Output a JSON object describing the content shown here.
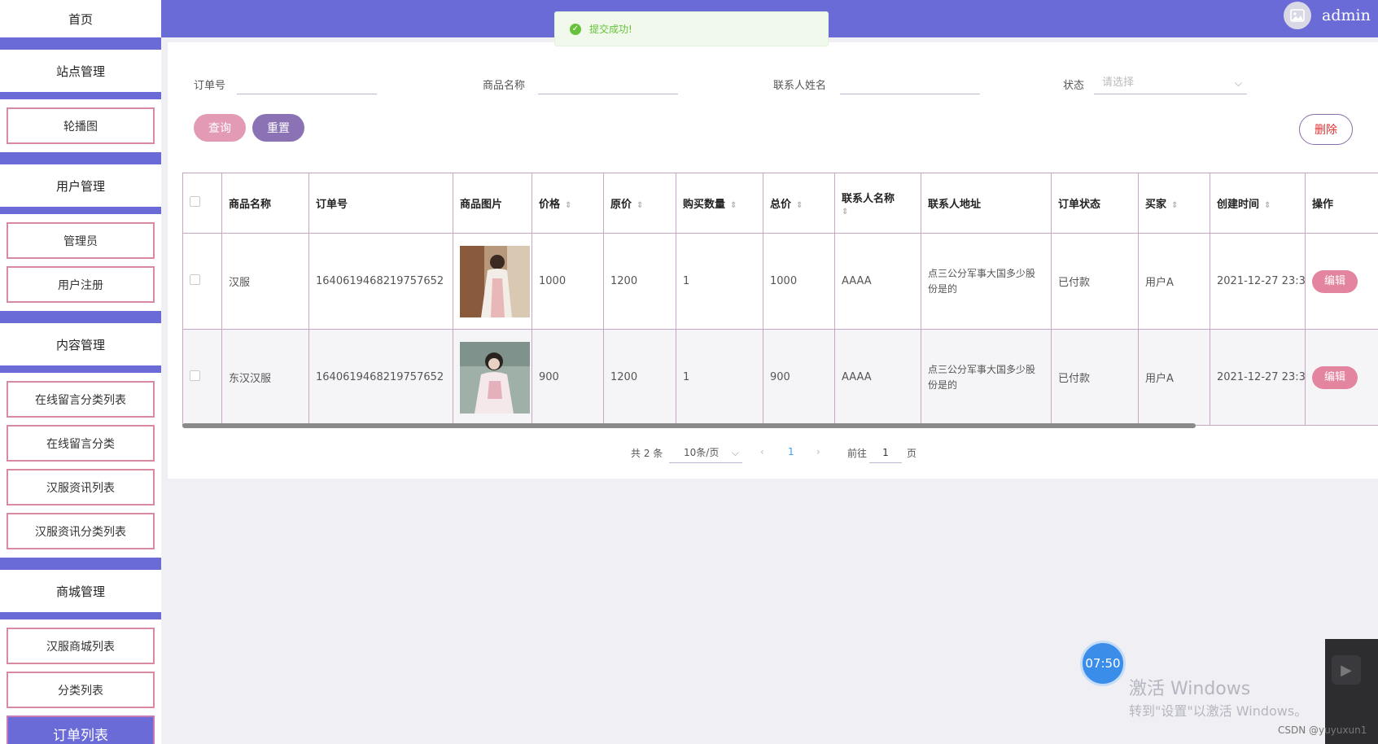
{
  "sidebar": {
    "home": "首页",
    "groups": [
      {
        "title": "站点管理",
        "items": [
          "轮播图"
        ]
      },
      {
        "title": "用户管理",
        "items": [
          "管理员",
          "用户注册"
        ]
      },
      {
        "title": "内容管理",
        "items": [
          "在线留言分类列表",
          "在线留言分类",
          "汉服资讯列表",
          "汉服资讯分类列表"
        ]
      },
      {
        "title": "商城管理",
        "items": [
          "汉服商城列表",
          "分类列表",
          "订单列表"
        ]
      }
    ],
    "active_item": "订单列表"
  },
  "header": {
    "username": "admin",
    "avatar_icon": "image-icon"
  },
  "toast": {
    "message": "提交成功!",
    "icon": "check-circle-icon"
  },
  "search": {
    "order_no_label": "订单号",
    "product_name_label": "商品名称",
    "contact_name_label": "联系人姓名",
    "status_label": "状态",
    "status_placeholder": "请选择",
    "query_button": "查询",
    "reset_button": "重置",
    "delete_button": "删除"
  },
  "table": {
    "columns": [
      "商品名称",
      "订单号",
      "商品图片",
      "价格",
      "原价",
      "购买数量",
      "总价",
      "联系人名称",
      "联系人地址",
      "订单状态",
      "买家",
      "创建时间",
      "操作"
    ],
    "rows": [
      {
        "product_name": "汉服",
        "order_no": "1640619468219757652",
        "price": "1000",
        "original_price": "1200",
        "quantity": "1",
        "total": "1000",
        "contact_name": "AAAA",
        "contact_address": "点三公分军事大国多少股份是的",
        "status": "已付款",
        "buyer": "用户A",
        "created": "2021-12-27 23:3",
        "action": "编辑"
      },
      {
        "product_name": "东汉汉服",
        "order_no": "1640619468219757652",
        "price": "900",
        "original_price": "1200",
        "quantity": "1",
        "total": "900",
        "contact_name": "AAAA",
        "contact_address": "点三公分军事大国多少股份是的",
        "status": "已付款",
        "buyer": "用户A",
        "created": "2021-12-27 23:3",
        "action": "编辑"
      }
    ]
  },
  "pagination": {
    "total_text": "共 2 条",
    "page_size": "10条/页",
    "current_page": "1",
    "goto_label": "前往",
    "goto_value": "1",
    "page_suffix": "页"
  },
  "overlay": {
    "timer": "07:50",
    "watermark_line1": "激活 Windows",
    "watermark_line2": "转到\"设置\"以激活 Windows。",
    "csdn": "CSDN @yuyuxun1"
  },
  "colors": {
    "accent": "#6a6bd6",
    "pink": "#e39ab4",
    "purple": "#8a72b5",
    "success": "#67c23a"
  }
}
